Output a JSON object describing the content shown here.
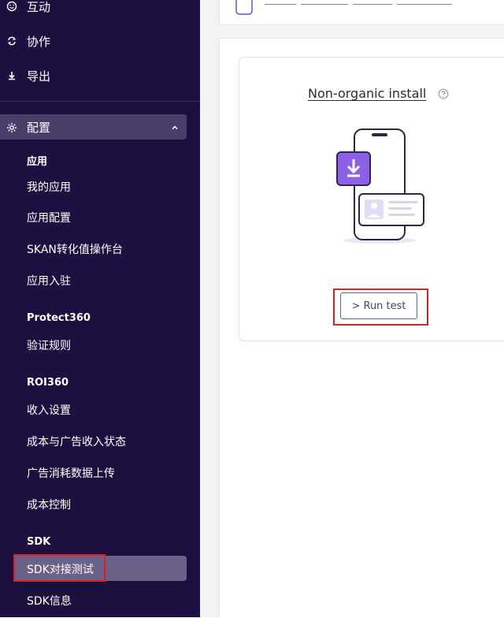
{
  "sidebar": {
    "nav_top": [
      {
        "label": "互动",
        "icon": "smile-icon"
      },
      {
        "label": "协作",
        "icon": "sync-icon"
      },
      {
        "label": "导出",
        "icon": "download-icon"
      }
    ],
    "section": {
      "label": "配置",
      "icon": "gear-icon",
      "expanded": true
    },
    "groups": [
      {
        "title": "应用",
        "items": [
          "我的应用",
          "应用配置",
          "SKAN转化值操作台",
          "应用入驻"
        ]
      },
      {
        "title": "Protect360",
        "items": [
          "验证规则"
        ]
      },
      {
        "title": "ROI360",
        "items": [
          "收入设置",
          "成本与广告收入状态",
          "广告消耗数据上传",
          "成本控制"
        ]
      },
      {
        "title": "SDK",
        "items": [
          "SDK对接测试",
          "SDK信息"
        ]
      }
    ],
    "active_item": "SDK对接测试"
  },
  "main": {
    "card": {
      "title": "Non-organic install",
      "run_button": "> Run test"
    }
  },
  "colors": {
    "sidebar_bg": "#1c1040",
    "accent_purple": "#7b4fe0",
    "highlight_red": "#e02020"
  }
}
